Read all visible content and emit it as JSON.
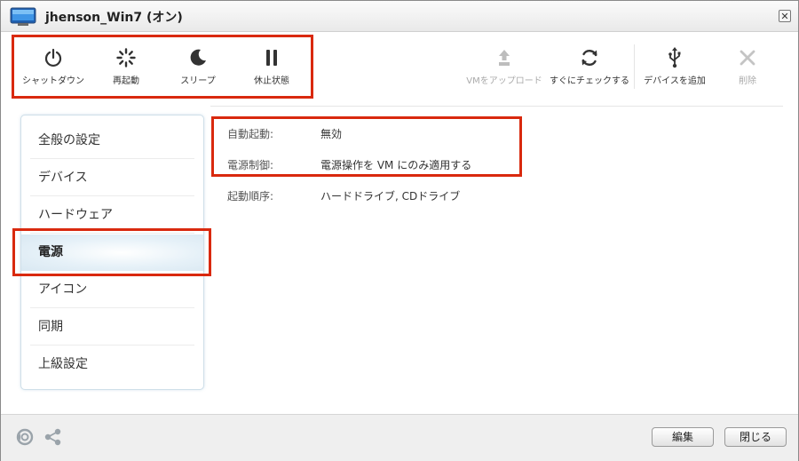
{
  "window": {
    "title": "jhenson_Win7 (オン)",
    "close_label": "✕"
  },
  "toolbar": {
    "left": [
      {
        "label": "シャットダウン",
        "icon": "power-icon"
      },
      {
        "label": "再起動",
        "icon": "restart-icon"
      },
      {
        "label": "スリープ",
        "icon": "sleep-icon"
      },
      {
        "label": "休止状態",
        "icon": "pause-icon"
      }
    ],
    "right": [
      {
        "label": "VMをアップロード",
        "icon": "upload-icon",
        "disabled": true
      },
      {
        "label": "すぐにチェックする",
        "icon": "refresh-icon",
        "disabled": false
      },
      {
        "label": "デバイスを追加",
        "icon": "usb-icon",
        "disabled": false
      },
      {
        "label": "削除",
        "icon": "delete-icon",
        "disabled": true
      }
    ]
  },
  "sidebar": {
    "items": [
      {
        "label": "全般の設定",
        "active": false
      },
      {
        "label": "デバイス",
        "active": false
      },
      {
        "label": "ハードウェア",
        "active": false
      },
      {
        "label": "電源",
        "active": true
      },
      {
        "label": "アイコン",
        "active": false
      },
      {
        "label": "同期",
        "active": false
      },
      {
        "label": "上級設定",
        "active": false
      }
    ]
  },
  "properties": [
    {
      "label": "自動起動:",
      "value": "無効"
    },
    {
      "label": "電源制御:",
      "value": "電源操作を VM にのみ適用する"
    },
    {
      "label": "起動順序:",
      "value": "ハードドライブ, CDドライブ"
    }
  ],
  "footer": {
    "edit_label": "編集",
    "close_label": "閉じる"
  },
  "colors": {
    "highlight": "#d9290e",
    "active_item_bg": "#d9e8f2"
  }
}
